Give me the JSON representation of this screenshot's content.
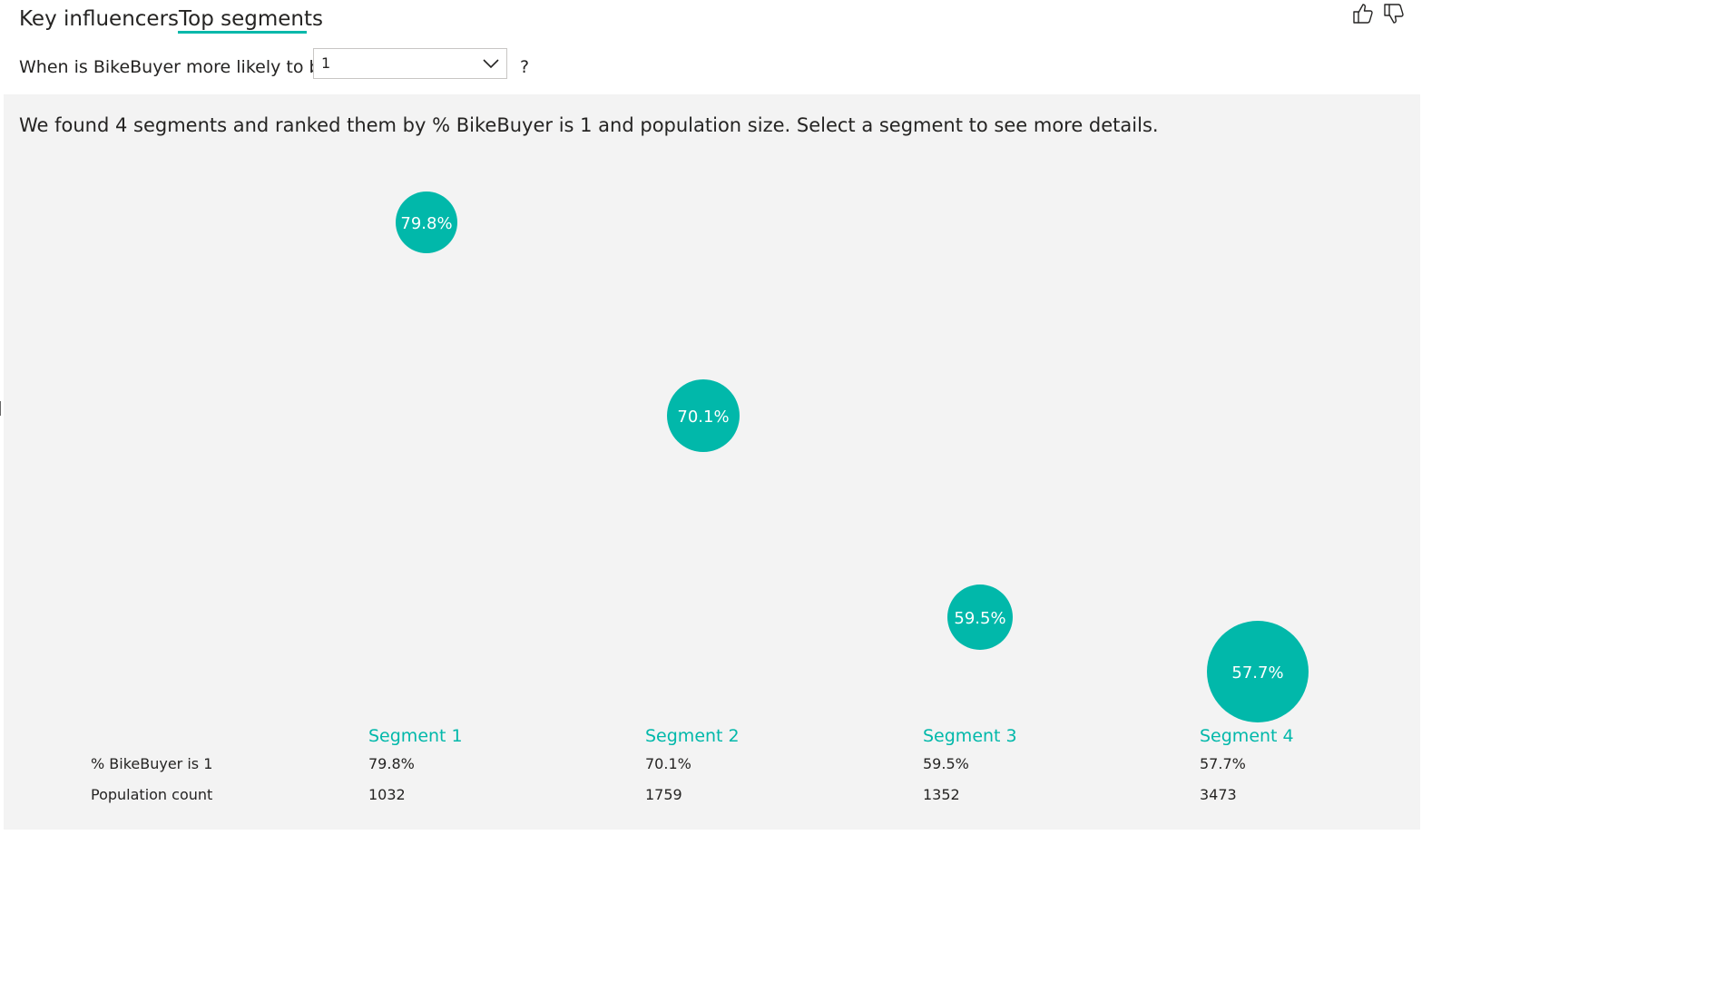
{
  "tabs": [
    {
      "label": "Key influencers",
      "active": false
    },
    {
      "label": "Top segments",
      "active": true
    }
  ],
  "accent_color": "#01b8aa",
  "feedback": {
    "like_icon": "thumbs-up-icon",
    "dislike_icon": "thumbs-down-icon"
  },
  "question": {
    "text": "When is BikeBuyer more likely to be",
    "selected_value": "1",
    "help": "?"
  },
  "summary": "We found 4 segments and ranked them by % BikeBuyer is 1 and population size. Select a segment to see more details.",
  "table": {
    "row_labels": [
      "% BikeBuyer is 1",
      "Population count"
    ]
  },
  "segments": [
    {
      "name": "Segment 1",
      "pct_label": "79.8%",
      "pct": 79.8,
      "population": "1032"
    },
    {
      "name": "Segment 2",
      "pct_label": "70.1%",
      "pct": 70.1,
      "population": "1759"
    },
    {
      "name": "Segment 3",
      "pct_label": "59.5%",
      "pct": 59.5,
      "population": "1352"
    },
    {
      "name": "Segment 4",
      "pct_label": "57.7%",
      "pct": 57.7,
      "population": "3473"
    }
  ]
}
